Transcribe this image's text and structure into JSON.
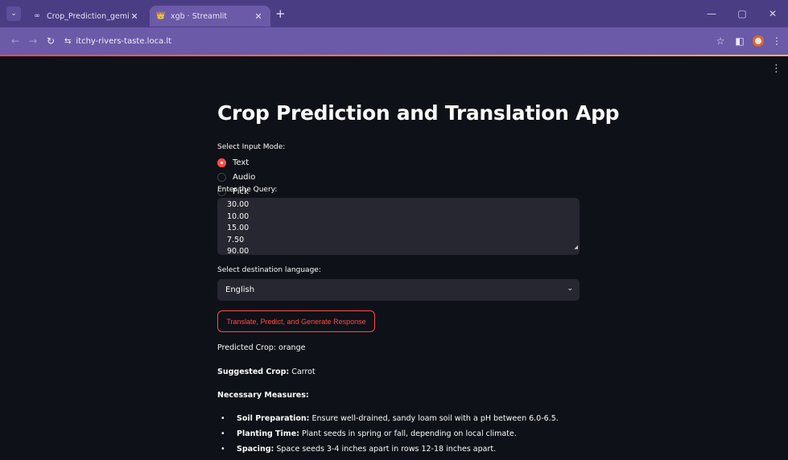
{
  "browser": {
    "tabs": [
      {
        "title": "Crop_Prediction_geminupynb",
        "favicon": "colab-icon",
        "active": false
      },
      {
        "title": "xgb · Streamlit",
        "favicon": "streamlit-icon",
        "active": true
      }
    ],
    "url": "itchy-rivers-taste.loca.lt"
  },
  "app": {
    "title": "Crop Prediction and Translation App",
    "input_mode_label": "Select Input Mode:",
    "input_modes": [
      {
        "label": "Text",
        "selected": true
      },
      {
        "label": "Audio",
        "selected": false
      },
      {
        "label": "Pick",
        "selected": false
      }
    ],
    "query_label": "Enter the Query:",
    "query_lines": [
      "30.00",
      "10.00",
      "15.00",
      "7.50",
      "90.00"
    ],
    "language_label": "Select destination language:",
    "language_value": "English",
    "submit_label": "Translate, Predict, and Generate Response",
    "predicted_label": "Predicted Crop: orange",
    "suggested_label": "Suggested Crop:",
    "suggested_value": "Carrot",
    "measures_heading": "Necessary Measures:",
    "measures": [
      {
        "title": "Soil Preparation:",
        "text": "Ensure well-drained, sandy loam soil with a pH between 6.0-6.5."
      },
      {
        "title": "Planting Time:",
        "text": "Plant seeds in spring or fall, depending on local climate."
      },
      {
        "title": "Spacing:",
        "text": "Space seeds 3-4 inches apart in rows 12-18 inches apart."
      }
    ]
  },
  "colors": {
    "background": "#0e1117",
    "accent": "#ff4b4b",
    "input_bg": "#262730",
    "browser_frame": "#4b3d84"
  }
}
